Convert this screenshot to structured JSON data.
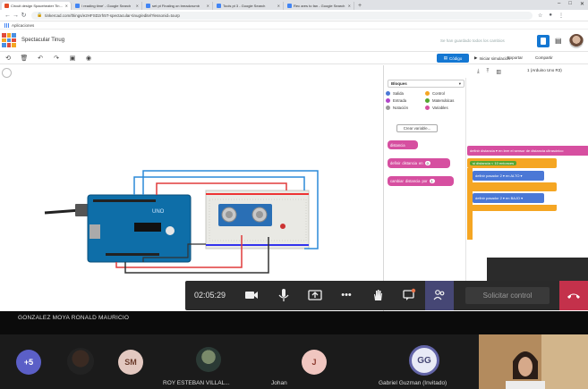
{
  "browser": {
    "tabs": [
      {
        "label": "Circuit design Spaceheater Tinug",
        "color": "#e34c26",
        "active": true
      },
      {
        "label": "\\ reading time' - Google Search",
        "color": "#4285f4",
        "active": false
      },
      {
        "label": "set pt Finaling on breadcrumb",
        "color": "#4285f4",
        "active": false
      },
      {
        "label": "Tools pt 3 - Google Search",
        "color": "#4285f4",
        "active": false
      },
      {
        "label": "Rec ares to fan - Google Search",
        "color": "#4285f4",
        "active": false
      }
    ],
    "new_tab_label": "+",
    "url": "tinkercad.com/things/e2HFSDzrh5T-spectacular-tinug/editel?lessonid=tourp",
    "bookmarks_label": "Aplicaciones"
  },
  "app": {
    "project_title": "Spectacular Tinug",
    "saved_text": "Se han guardado todos los cambios",
    "toolbar": {
      "code_label": "Código",
      "sim_label": "Iniciar simulación",
      "export_label": "Exportar",
      "share_label": "Compartir"
    },
    "code_panel": {
      "mode": "Bloques",
      "board": "1 (Arduino Uno R3)",
      "categories": [
        {
          "label": "Salida",
          "color": "#4b78d6"
        },
        {
          "label": "Control",
          "color": "#f5a623"
        },
        {
          "label": "Entrada",
          "color": "#b145c8"
        },
        {
          "label": "Matemáticas",
          "color": "#55a630"
        },
        {
          "label": "Notación",
          "color": "#9a9a9a"
        },
        {
          "label": "Variables",
          "color": "#d64fa0"
        }
      ],
      "new_variable_label": "Crear variable...",
      "palette_blocks": {
        "var_label": "distancia",
        "set_label": "definir",
        "set_var": "distancia",
        "set_to": "en",
        "set_value": "0",
        "change_label": "cambiar",
        "change_var": "distancia",
        "change_by": "por",
        "change_value": "1"
      },
      "workspace_blocks": {
        "b1": "definir  distancia ▾  en  leer el sensor de distancia ultrasónico",
        "b2": "si  distancia  <  10  entonces",
        "b3": "definir pasador  2 ▾  en  ALTO ▾",
        "b4": "definir pasador  2 ▾  en  BAJO ▾",
        "b2_value": "10"
      }
    }
  },
  "meeting": {
    "timer": "02:05:29",
    "request_control_label": "Solicitar control",
    "presenter_name": "GONZALEZ MOYA RONALD MAURICIO",
    "participants": [
      {
        "label": "+5",
        "name": ""
      },
      {
        "label": "",
        "name": ""
      },
      {
        "label": "SM",
        "name": ""
      },
      {
        "label": "",
        "name": "ROY ESTEBAN VILLAL..."
      },
      {
        "label": "J",
        "name": "Johan"
      },
      {
        "label": "GG",
        "name": "Gabriel Guzman (Invitado)"
      },
      {
        "label": "",
        "name": ""
      }
    ]
  }
}
